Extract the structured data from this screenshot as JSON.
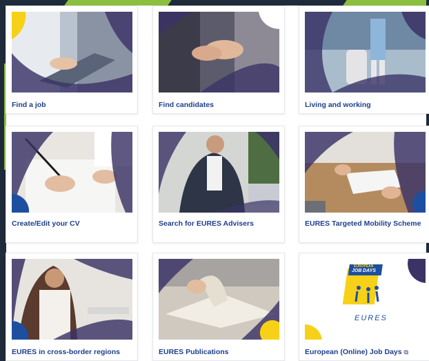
{
  "cards": [
    {
      "label": "Find a job",
      "image": "person-typing-laptop-photo",
      "theme": "#5a6478"
    },
    {
      "label": "Find candidates",
      "image": "handshake-photo",
      "theme": "#4d4c5e"
    },
    {
      "label": "Living and working",
      "image": "traveller-with-suitcase-photo",
      "theme": "#7f96ae"
    },
    {
      "label": "Create/Edit your CV",
      "image": "hand-writing-document-photo",
      "theme": "#d8d3cb"
    },
    {
      "label": "Search for EURES Advisers",
      "image": "man-phone-laptop-photo",
      "theme": "#6a6a70"
    },
    {
      "label": "EURES Targeted Mobility Scheme",
      "image": "handing-over-paper-photo",
      "theme": "#9a8066"
    },
    {
      "label": "EURES in cross-border regions",
      "image": "woman-with-phone-photo",
      "theme": "#8c7562"
    },
    {
      "label": "EURES Publications",
      "image": "hand-flipping-pages-photo",
      "theme": "#b8b2a8"
    },
    {
      "label": "European (Online) Job Days",
      "image": "european-job-days-logo",
      "theme": "#ffffff",
      "external": true
    }
  ],
  "logo": {
    "line1": "EUROPEAN",
    "line2": "JOB",
    "line3": "DAYS",
    "wordmark": "EURES"
  },
  "external_icon": "external-link-icon",
  "colors": {
    "label": "#1e3f8c",
    "overlay_purple": "#3b3366",
    "accent_yellow": "#f7d117",
    "logo_blue": "#1d4fa0"
  }
}
